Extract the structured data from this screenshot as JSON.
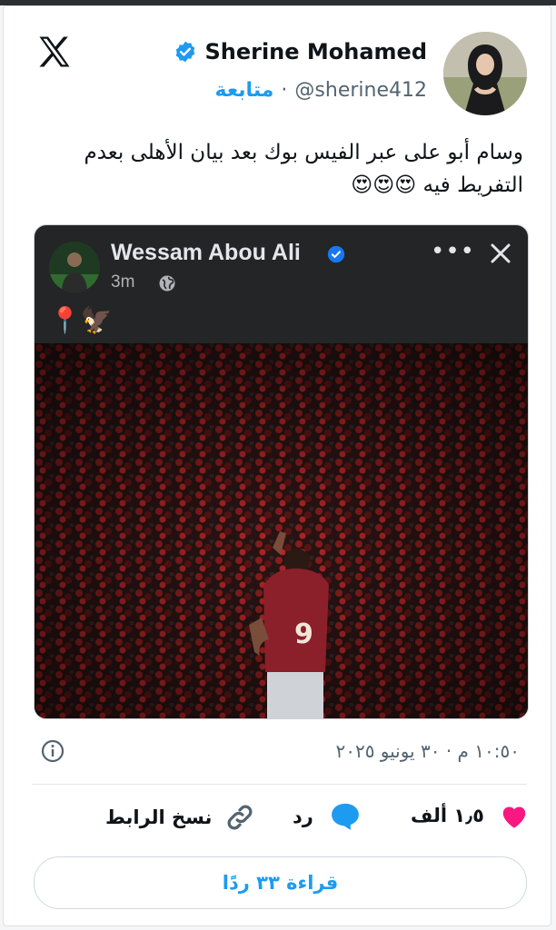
{
  "brand": {
    "logo_icon": "x-logo-icon"
  },
  "author": {
    "name": "Sherine Mohamed",
    "handle": "@sherine412",
    "follow_label": "متابعة",
    "separator": "·",
    "verified_icon": "verified-badge-icon"
  },
  "tweet": {
    "text": "وسام أبو على عبر الفيس بوك بعد بيان الأهلى بعدم التفريط فيه 😍😍😍"
  },
  "embedded_post": {
    "author_name": "Wessam Abou Ali",
    "time": "3m",
    "emoji_line": "📍🦅",
    "more_icon": "more-horizontal-icon",
    "close_icon": "close-icon",
    "audience_icon": "globe-icon",
    "photo_jersey_number": "9"
  },
  "meta": {
    "timestamp": "١٠:٥٠ م · ٣٠ يونيو ٢٠٢٥",
    "info_icon": "info-icon"
  },
  "actions": {
    "likes": "١٫٥ ألف",
    "reply_label": "رد",
    "copy_link_label": "نسخ الرابط"
  },
  "read_replies_label": "قراءة ٣٣ ردًا",
  "colors": {
    "accent": "#1d9bf0",
    "heart": "#f91880",
    "fb_bg": "#242526"
  }
}
